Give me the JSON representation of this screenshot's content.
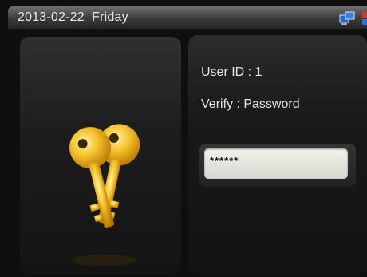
{
  "status_bar": {
    "date": "2013-02-22",
    "weekday": "Friday",
    "icons": [
      "network-icon",
      "fingerprint-icon"
    ]
  },
  "left_panel": {
    "icon": "keys-icon"
  },
  "right_panel": {
    "user_id_label": "User ID : 1",
    "verify_label": "Verify : Password",
    "password_value": "******"
  },
  "colors": {
    "screen_bg": "#0f0f0f",
    "key_gold": "#f2b31e",
    "text": "#e6e6e6"
  }
}
